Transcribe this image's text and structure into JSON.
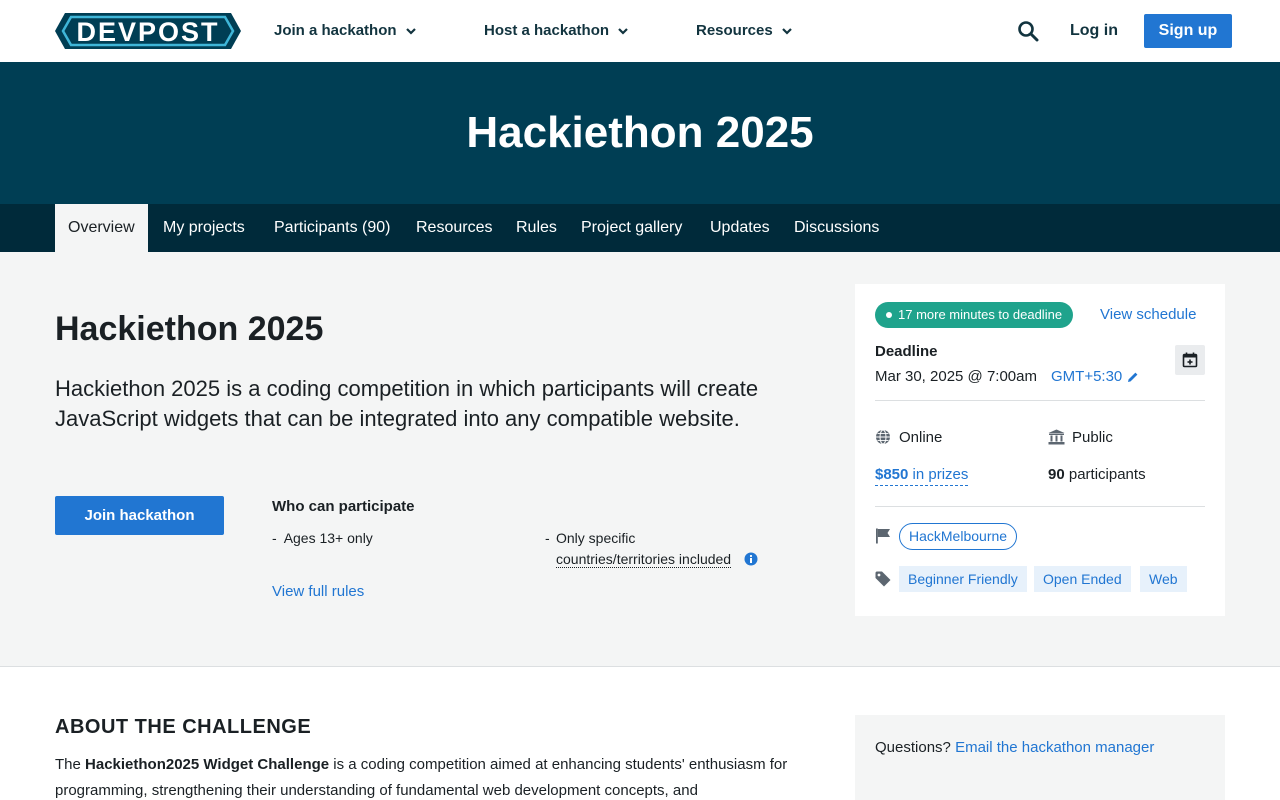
{
  "brand": {
    "logo_text": "DEVPOST"
  },
  "nav": {
    "join": "Join a hackathon",
    "host": "Host a hackathon",
    "resources": "Resources",
    "login": "Log in",
    "signup": "Sign up"
  },
  "hero": {
    "title": "Hackiethon 2025"
  },
  "tabs": [
    {
      "label": "Overview"
    },
    {
      "label": "My projects"
    },
    {
      "label": "Participants (90)"
    },
    {
      "label": "Resources"
    },
    {
      "label": "Rules"
    },
    {
      "label": "Project gallery"
    },
    {
      "label": "Updates"
    },
    {
      "label": "Discussions"
    }
  ],
  "overview": {
    "title": "Hackiethon 2025",
    "description": "Hackiethon 2025 is a coding competition in which participants will create JavaScript widgets that can be integrated into any compatible website.",
    "join_button": "Join hackathon",
    "who_title": "Who can participate",
    "dash": "-",
    "ages": "Ages 13+ only",
    "countries_line1": "Only specific",
    "countries_line2": "countries/territories included",
    "view_rules": "View full rules"
  },
  "sidebar": {
    "countdown": "17 more minutes to deadline",
    "view_schedule": "View schedule",
    "deadline_label": "Deadline",
    "deadline_date": "Mar 30, 2025 @ 7:00am",
    "timezone": "GMT+5:30",
    "location": "Online",
    "visibility": "Public",
    "prize_amount": "$850",
    "prize_suffix": "in prizes",
    "participant_count": "90",
    "participant_suffix": "participants",
    "host": "HackMelbourne",
    "themes": [
      "Beginner Friendly",
      "Open Ended",
      "Web"
    ]
  },
  "about": {
    "title": "ABOUT THE CHALLENGE",
    "intro_prefix": "The ",
    "intro_bold": "Hackiethon2025 Widget Challenge",
    "intro_rest": " is a coding competition aimed at enhancing students' enthusiasm for programming, strengthening their understanding of fundamental web development concepts, and"
  },
  "questions": {
    "prefix": "Questions?",
    "link": "Email the hackathon manager"
  },
  "colors": {
    "primary": "#2176d2",
    "hero_bg": "#003e54",
    "tabs_bg": "#002a3a",
    "countdown_bg": "#1fa38c"
  }
}
